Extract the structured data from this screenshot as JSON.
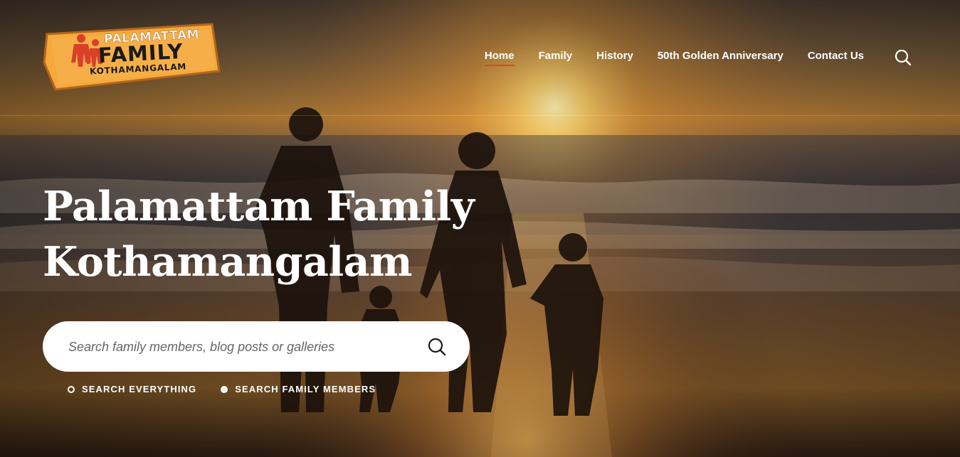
{
  "logo": {
    "line1": "PALAMATTAM",
    "line2": "FAMILY",
    "line3": "KOTHAMANGALAM"
  },
  "nav": {
    "items": [
      {
        "label": "Home",
        "active": true
      },
      {
        "label": "Family"
      },
      {
        "label": "History"
      },
      {
        "label": "50th Golden Anniversary"
      },
      {
        "label": "Contact Us"
      }
    ],
    "search_icon": "search-icon"
  },
  "hero": {
    "title_line1": "Palamattam Family",
    "title_line2": "Kothamangalam"
  },
  "search": {
    "placeholder": "Search family members, blog posts or galleries",
    "value": "",
    "submit_icon": "search-icon",
    "options": [
      {
        "label": "SEARCH EVERYTHING",
        "selected": false
      },
      {
        "label": "SEARCH FAMILY MEMBERS",
        "selected": true
      }
    ]
  },
  "colors": {
    "accent": "#e0452b",
    "logo_board": "#f5a93a",
    "logo_red": "#d8402a"
  }
}
